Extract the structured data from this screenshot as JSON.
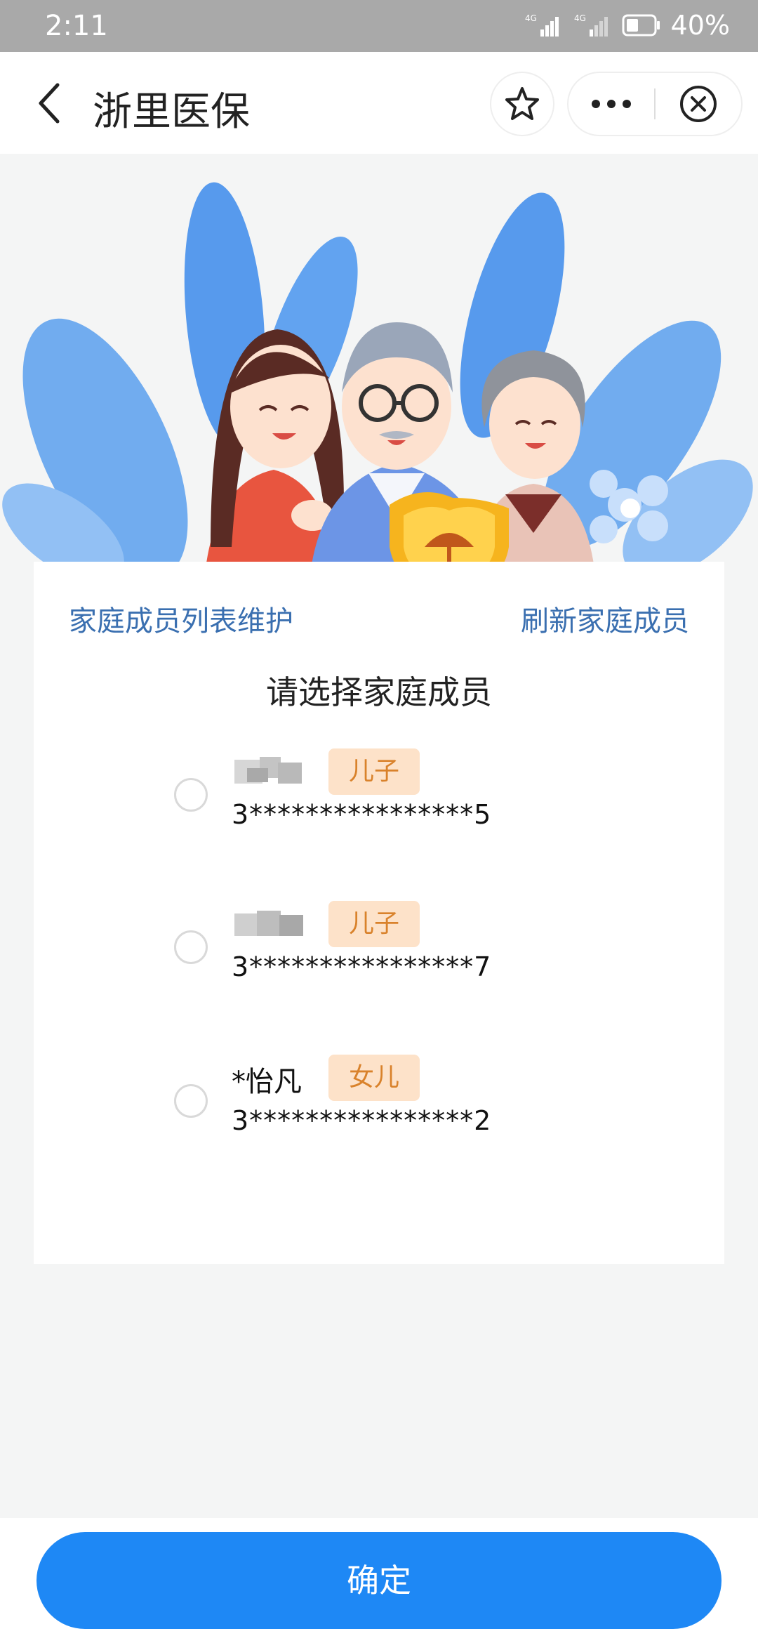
{
  "status_bar": {
    "time": "2:11",
    "battery_percent": "40%",
    "network": [
      "4G",
      "4G"
    ]
  },
  "title_bar": {
    "title": "浙里医保",
    "icons": {
      "back": "chevron-left-icon",
      "favorite": "star-icon",
      "more": "more-dots-icon",
      "close": "close-circle-icon"
    }
  },
  "hero": {
    "image": "family-illustration-with-shield"
  },
  "card": {
    "link_left": "家庭成员列表维护",
    "link_right": "刷新家庭成员",
    "prompt": "请选择家庭成员",
    "members": [
      {
        "name": "",
        "relation": "儿子",
        "id": "3****************5",
        "selected": false
      },
      {
        "name": "",
        "relation": "儿子",
        "id": "3****************7",
        "selected": false
      },
      {
        "name": "*怡凡",
        "relation": "女儿",
        "id": "3****************2",
        "selected": false
      }
    ]
  },
  "footer": {
    "confirm": "确定"
  },
  "colors": {
    "accent": "#1e88f5",
    "link": "#3a6fb0",
    "tag_bg": "#fde2c9",
    "tag_text": "#d9822b"
  }
}
